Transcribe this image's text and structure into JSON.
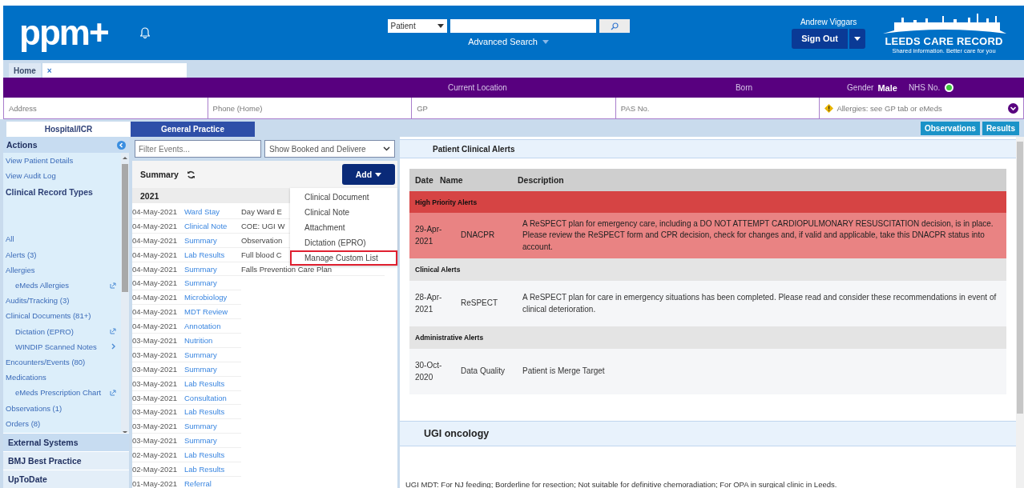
{
  "header": {
    "logo": "ppm+",
    "search_type": "Patient",
    "advanced_search": "Advanced Search",
    "user": "Andrew Viggars",
    "sign_out": "Sign Out",
    "brand": "LEEDS CARE RECORD",
    "brand_tagline": "Shared information. Better care for you"
  },
  "doc_tabs": [
    {
      "label": "Home",
      "selected": false
    },
    {
      "close": "×",
      "selected": true
    }
  ],
  "patient_bar": {
    "current_location": "Current Location",
    "born": "Born",
    "gender_label": "Gender",
    "gender": "Male",
    "nhs_label": "NHS No."
  },
  "patient_fields": [
    {
      "label": "Address"
    },
    {
      "label": "Phone (Home)"
    },
    {
      "label": "GP"
    },
    {
      "label": "PAS No."
    },
    {
      "label": "Allergies: see GP tab or eMeds",
      "warning": true
    }
  ],
  "view_tabs": [
    {
      "label": "Hospital/ICR",
      "selected": true
    },
    {
      "label": "General Practice",
      "selected": false
    }
  ],
  "action_buttons": [
    "Observations",
    "Results"
  ],
  "sidebar": {
    "title": "Actions",
    "items": [
      {
        "kind": "link",
        "label": "View Patient Details"
      },
      {
        "kind": "link",
        "label": "View Audit Log"
      },
      {
        "kind": "heading",
        "label": "Clinical Record Types"
      },
      {
        "kind": "spacer"
      },
      {
        "kind": "item",
        "label": "All"
      },
      {
        "kind": "item",
        "label": "Alerts (3)"
      },
      {
        "kind": "item",
        "label": "Allergies"
      },
      {
        "kind": "linked",
        "label": "eMeds Allergies"
      },
      {
        "kind": "item",
        "label": "Audits/Tracking (3)"
      },
      {
        "kind": "item",
        "label": "Clinical Documents (81+)"
      },
      {
        "kind": "linked",
        "label": "Dictation (EPRO)"
      },
      {
        "kind": "expandable",
        "label": "WINDIP Scanned Notes"
      },
      {
        "kind": "item",
        "label": "Encounters/Events (80)"
      },
      {
        "kind": "item",
        "label": "Medications"
      },
      {
        "kind": "linked",
        "label": "eMeds Prescription Chart"
      },
      {
        "kind": "item",
        "label": "Observations (1)"
      },
      {
        "kind": "item",
        "label": "Orders (8)"
      }
    ],
    "sections": [
      "External Systems",
      "BMJ Best Practice",
      "UpToDate"
    ]
  },
  "events": {
    "filter_placeholder": "Filter Events...",
    "show_filter": "Show Booked and Delivere",
    "title": "Summary",
    "add": "Add",
    "year": "2021",
    "rows": [
      {
        "date": "04-May-2021",
        "type": "Ward Stay",
        "detail": "Day Ward E"
      },
      {
        "date": "04-May-2021",
        "type": "Clinical Note",
        "detail": "COE: UGI W"
      },
      {
        "date": "04-May-2021",
        "type": "Summary",
        "detail": "Observation"
      },
      {
        "date": "04-May-2021",
        "type": "Lab Results",
        "detail": "Full blood C"
      },
      {
        "date": "04-May-2021",
        "type": "Summary",
        "detail": "Falls Prevention Care Plan"
      },
      {
        "date": "04-May-2021",
        "type": "Summary"
      },
      {
        "date": "04-May-2021",
        "type": "Microbiology"
      },
      {
        "date": "04-May-2021",
        "type": "MDT Review"
      },
      {
        "date": "04-May-2021",
        "type": "Annotation"
      },
      {
        "date": "03-May-2021",
        "type": "Nutrition"
      },
      {
        "date": "03-May-2021",
        "type": "Summary"
      },
      {
        "date": "03-May-2021",
        "type": "Summary"
      },
      {
        "date": "03-May-2021",
        "type": "Lab Results"
      },
      {
        "date": "03-May-2021",
        "type": "Consultation"
      },
      {
        "date": "03-May-2021",
        "type": "Lab Results"
      },
      {
        "date": "03-May-2021",
        "type": "Summary"
      },
      {
        "date": "03-May-2021",
        "type": "Summary"
      },
      {
        "date": "02-May-2021",
        "type": "Lab Results"
      },
      {
        "date": "02-May-2021",
        "type": "Lab Results"
      },
      {
        "date": "01-May-2021",
        "type": "Referral"
      }
    ],
    "add_menu": [
      {
        "label": "Clinical Document",
        "highlighted": false
      },
      {
        "label": "Clinical Note",
        "highlighted": false
      },
      {
        "label": "Attachment",
        "highlighted": false
      },
      {
        "label": "Dictation (EPRO)",
        "highlighted": false
      },
      {
        "label": "Manage Custom List",
        "highlighted": true
      }
    ]
  },
  "alerts": {
    "title": "Patient Clinical Alerts",
    "columns": [
      "Date",
      "Name",
      "Description"
    ],
    "groups": [
      {
        "title": "High Priority Alerts",
        "high_priority": true,
        "rows": [
          {
            "date": "29-Apr-2021",
            "name": "DNACPR",
            "description": "A ReSPECT plan for emergency care, including a DO NOT ATTEMPT CARDIOPULMONARY RESUSCITATION decision, is in place. Please review the ReSPECT form and CPR decision, check for changes and, if valid and applicable, take this DNACPR status into account."
          }
        ]
      },
      {
        "title": "Clinical Alerts",
        "high_priority": false,
        "rows": [
          {
            "date": "28-Apr-2021",
            "name": "ReSPECT",
            "description": "A ReSPECT plan for care in emergency situations has been completed. Please read and consider these recommendations in event of clinical deterioration."
          }
        ]
      },
      {
        "title": "Administrative Alerts",
        "high_priority": false,
        "rows": [
          {
            "date": "30-Oct-2020",
            "name": "Data Quality",
            "description": "Patient is Merge Target"
          }
        ]
      }
    ]
  },
  "oncology": {
    "title": "UGI oncology",
    "text": "UGI MDT: For NJ feeding; Borderline for resection; Not suitable for definitive chemoradiation; For OPA in surgical clinic in Leeds."
  }
}
